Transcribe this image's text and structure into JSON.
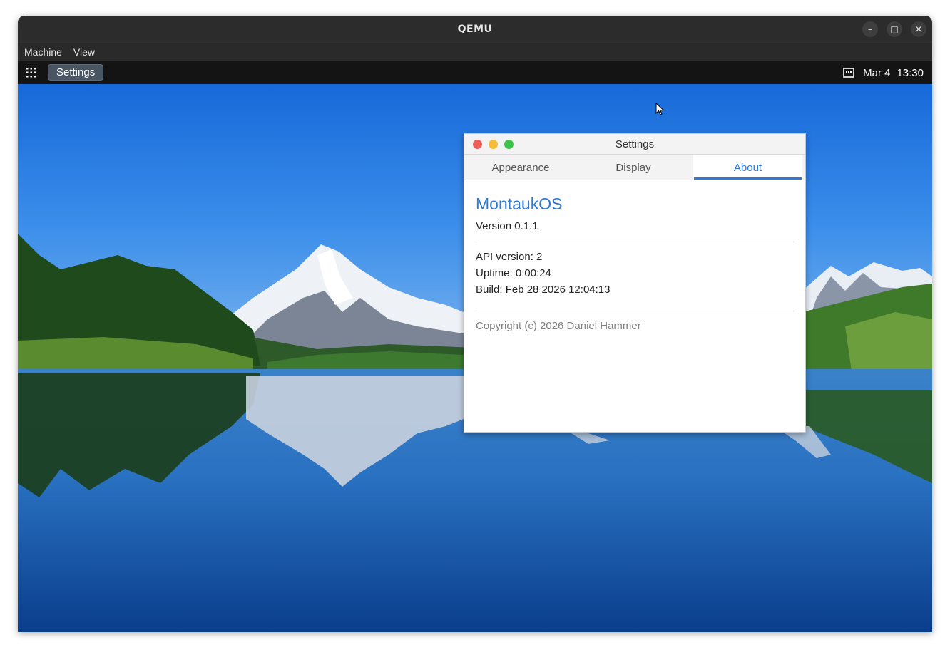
{
  "host_window": {
    "title": "QEMU",
    "controls": {
      "minimize": "–",
      "maximize": "□",
      "close": "✕"
    },
    "menu": [
      "Machine",
      "View"
    ]
  },
  "guest": {
    "taskbar": {
      "running_app": "Settings",
      "date": "Mar 4",
      "time": "13:30"
    },
    "settings_window": {
      "title": "Settings",
      "tabs": [
        "Appearance",
        "Display",
        "About"
      ],
      "active_tab": "About",
      "about": {
        "os_name": "MontaukOS",
        "version": "Version 0.1.1",
        "api_version": "API version: 2",
        "uptime": "Uptime: 0:00:24",
        "build": "Build: Feb 28 2026 12:04:13",
        "copyright": "Copyright (c) 2026 Daniel Hammer"
      }
    }
  },
  "colors": {
    "accent": "#2f7ad8",
    "taskbar": "#141414",
    "host_titlebar": "#2c2c2c"
  }
}
